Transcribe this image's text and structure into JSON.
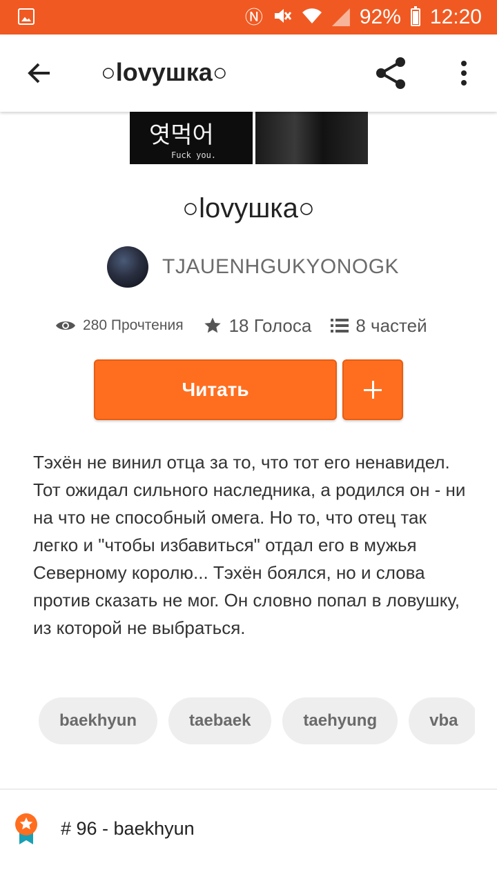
{
  "status_bar": {
    "battery": "92%",
    "time": "12:20",
    "icons": [
      "gallery-icon",
      "n-icon",
      "mute-icon",
      "wifi-icon",
      "signal-icon",
      "battery-icon"
    ]
  },
  "toolbar": {
    "title": "○lovушка○"
  },
  "cover": {
    "korean_text": "엿먹어",
    "sub_text": "Fuck you."
  },
  "story": {
    "title": "○lovушка○",
    "author": "TJAUENHGUKYONOGK",
    "stats": {
      "reads": "280 Прочтения",
      "votes": "18 Голоса",
      "parts": "8 частей"
    },
    "read_label": "Читать",
    "description": "Тэхён не винил отца за то, что тот его ненавидел. Тот ожидал сильного наследника, а родился он - ни на что не способный омега. Но то, что отец так легко и \"чтобы избавиться\" отдал его в мужья Северному королю... Тэхён боялся, но и слова против сказать не мог. Он словно попал в ловушку, из которой не выбраться.",
    "tags": [
      "baekhyun",
      "taebaek",
      "taehyung",
      "vba"
    ]
  },
  "ranking": {
    "text": "# 96 - baekhyun"
  },
  "colors": {
    "accent": "#ff6e1f",
    "status_bar": "#f05a22",
    "tag_bg": "#eeeeee"
  }
}
